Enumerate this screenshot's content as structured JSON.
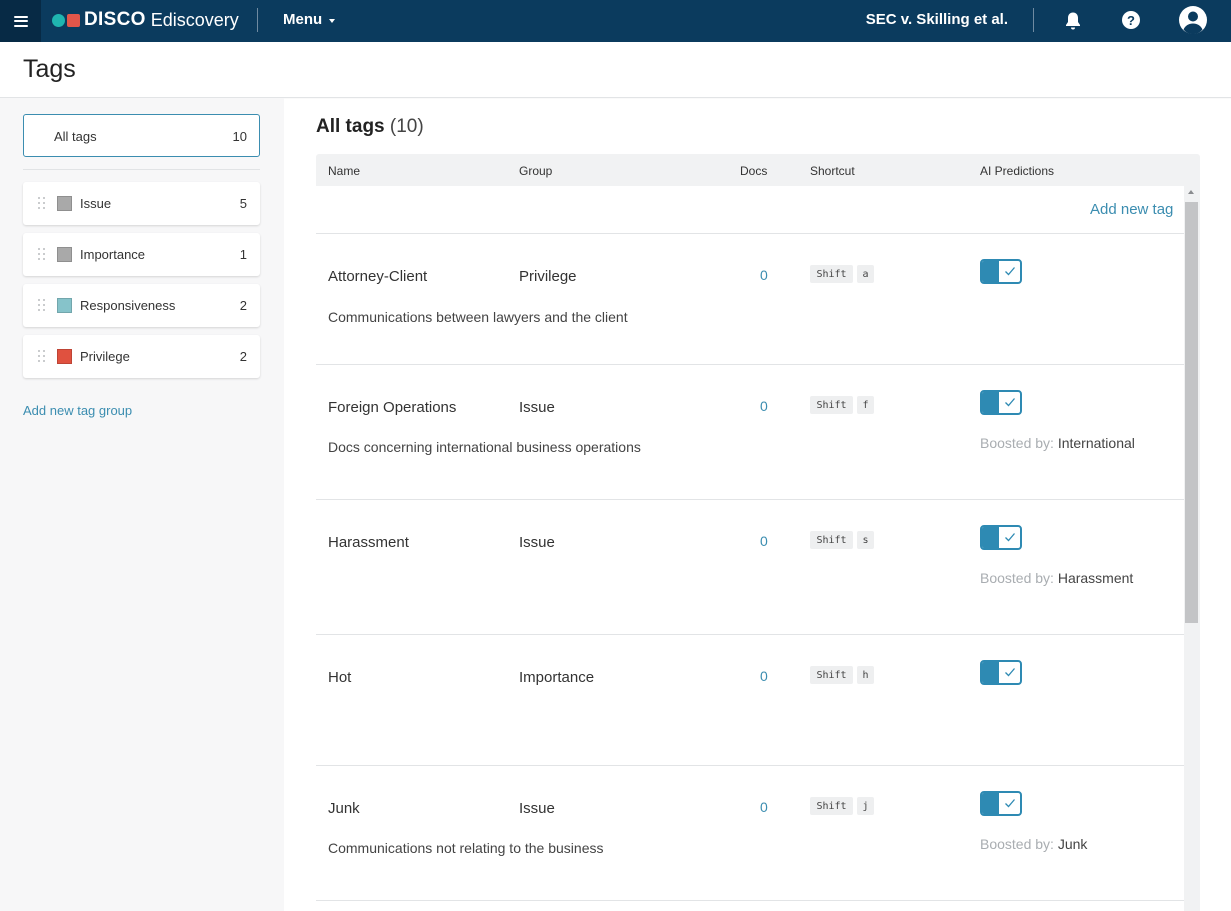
{
  "topbar": {
    "brand": "DISCO",
    "product": "Ediscovery",
    "menu_label": "Menu",
    "case_name": "SEC v. Skilling et al.",
    "help_label": "?",
    "icons": [
      "hamburger-icon",
      "bell-icon",
      "help-icon",
      "user-avatar-icon"
    ]
  },
  "page": {
    "title": "Tags"
  },
  "sidebar": {
    "all_tags": {
      "label": "All tags",
      "count": "10"
    },
    "groups": [
      {
        "label": "Issue",
        "count": "5",
        "color": "#a9a9a9"
      },
      {
        "label": "Importance",
        "count": "1",
        "color": "#a9a9a9"
      },
      {
        "label": "Responsiveness",
        "count": "2",
        "color": "#86c3ca"
      },
      {
        "label": "Privilege",
        "count": "2",
        "color": "#e0513f"
      }
    ],
    "add_group_label": "Add new tag group"
  },
  "main": {
    "title": "All tags",
    "count": "(10)",
    "columns": [
      "Name",
      "Group",
      "Docs",
      "Shortcut",
      "AI Predictions"
    ],
    "add_tag_label": "Add new tag",
    "boost_prefix": "Boosted by:",
    "rows": [
      {
        "name": "Attorney-Client",
        "group": "Privilege",
        "docs": "0",
        "shortcut_mod": "Shift",
        "shortcut_key": "a",
        "description": "Communications between lawyers and the client",
        "ai_enabled": true,
        "boosted_by": ""
      },
      {
        "name": "Foreign Operations",
        "group": "Issue",
        "docs": "0",
        "shortcut_mod": "Shift",
        "shortcut_key": "f",
        "description": "Docs concerning international business operations",
        "ai_enabled": true,
        "boosted_by": "International"
      },
      {
        "name": "Harassment",
        "group": "Issue",
        "docs": "0",
        "shortcut_mod": "Shift",
        "shortcut_key": "s",
        "description": "",
        "ai_enabled": true,
        "boosted_by": "Harassment"
      },
      {
        "name": "Hot",
        "group": "Importance",
        "docs": "0",
        "shortcut_mod": "Shift",
        "shortcut_key": "h",
        "description": "",
        "ai_enabled": true,
        "boosted_by": ""
      },
      {
        "name": "Junk",
        "group": "Issue",
        "docs": "0",
        "shortcut_mod": "Shift",
        "shortcut_key": "j",
        "description": "Communications not relating to the business",
        "ai_enabled": true,
        "boosted_by": "Junk"
      }
    ]
  }
}
